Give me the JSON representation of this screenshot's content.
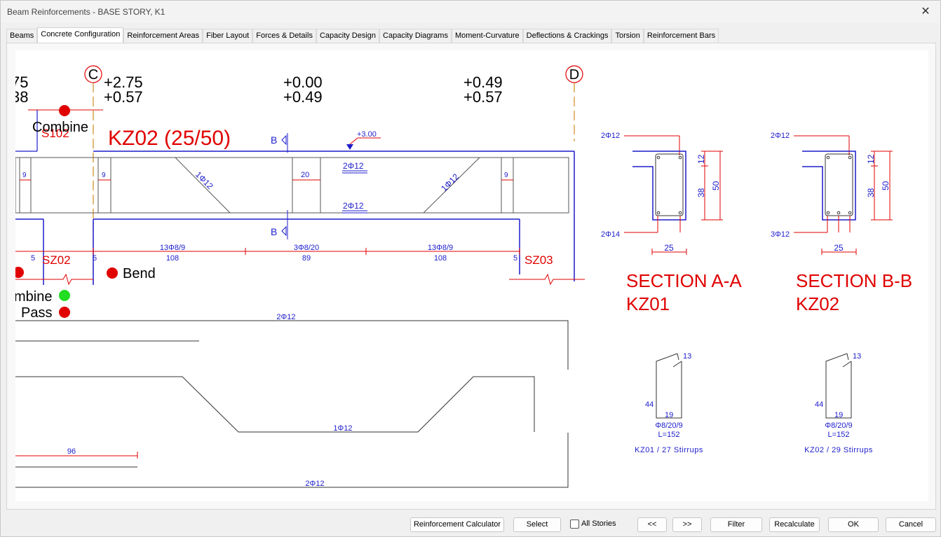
{
  "window": {
    "title": "Beam Reinforcements - BASE STORY, K1",
    "close_glyph": "✕"
  },
  "tabs": [
    {
      "label": "Beams"
    },
    {
      "label": "Concrete Configuration"
    },
    {
      "label": "Reinforcement Areas"
    },
    {
      "label": "Fiber Layout"
    },
    {
      "label": "Forces & Details"
    },
    {
      "label": "Capacity Design"
    },
    {
      "label": "Capacity Diagrams"
    },
    {
      "label": "Moment-Curvature"
    },
    {
      "label": "Deflections & Crackings"
    },
    {
      "label": "Torsion"
    },
    {
      "label": "Reinforcement Bars"
    }
  ],
  "active_tab": "Concrete Configuration",
  "drawing": {
    "axis_c": "C",
    "axis_d": "D",
    "left_partial_top": "75",
    "left_partial_bot": "38",
    "moments_1_top": "+2.75",
    "moments_1_bot": "+0.57",
    "moments_2_top": "+0.00",
    "moments_2_bot": "+0.49",
    "moments_3_top": "+0.49",
    "moments_3_bot": "+0.57",
    "s102": "S102",
    "combine_top": "Combine",
    "beam_title": "KZ02 (25/50)",
    "section_mark": "B",
    "level": "+3.00",
    "top_bar": "2Φ12",
    "bottom_bar": "2Φ12",
    "bent_bar": "1Φ12",
    "dim_9": "9",
    "dim_20": "20",
    "dim_5": "5",
    "stirrup_zone_1": "13Φ8/9",
    "stirrup_zone_2": "3Φ8/20",
    "stirrup_zone_3": "13Φ8/9",
    "len_1": "108",
    "len_2": "89",
    "len_3": "108",
    "sz02": "SZ02",
    "sz03": "SZ03",
    "bend": "Bend",
    "combine_partial": "mbine",
    "pass_label": "Pass",
    "bar_top_long": "2Φ12",
    "bar_bent_long": "1Φ12",
    "bar_bottom_long": "2Φ12",
    "dim_96": "96",
    "sec_a": {
      "top": "2Φ12",
      "bottom": "2Φ14",
      "d12": "12",
      "d38": "38",
      "d50": "50",
      "width": "25",
      "title": "SECTION A-A",
      "name": "KZ01"
    },
    "sec_b": {
      "top": "2Φ12",
      "bottom": "3Φ12",
      "d12": "12",
      "d38": "38",
      "d50": "50",
      "width": "25",
      "title": "SECTION B-B",
      "name": "KZ02"
    },
    "stirrup_a": {
      "hook": "13",
      "h": "44",
      "w": "19",
      "spec": "Φ8/20/9",
      "len": "L=152",
      "caption": "KZ01 / 27 Stirrups"
    },
    "stirrup_b": {
      "hook": "13",
      "h": "44",
      "w": "19",
      "spec": "Φ8/20/9",
      "len": "L=152",
      "caption": "KZ02 / 29 Stirrups"
    }
  },
  "buttons": {
    "calculator": "Reinforcement Calculator",
    "select": "Select",
    "all_stories": "All Stories",
    "prev": "<<",
    "next": ">>",
    "filter": "Filter",
    "recalculate": "Recalculate",
    "ok": "OK",
    "cancel": "Cancel"
  },
  "colors": {
    "blue": "#1c1ccc",
    "red": "#e00000",
    "green": "#22dd22",
    "axis_orange": "#d08a20"
  }
}
